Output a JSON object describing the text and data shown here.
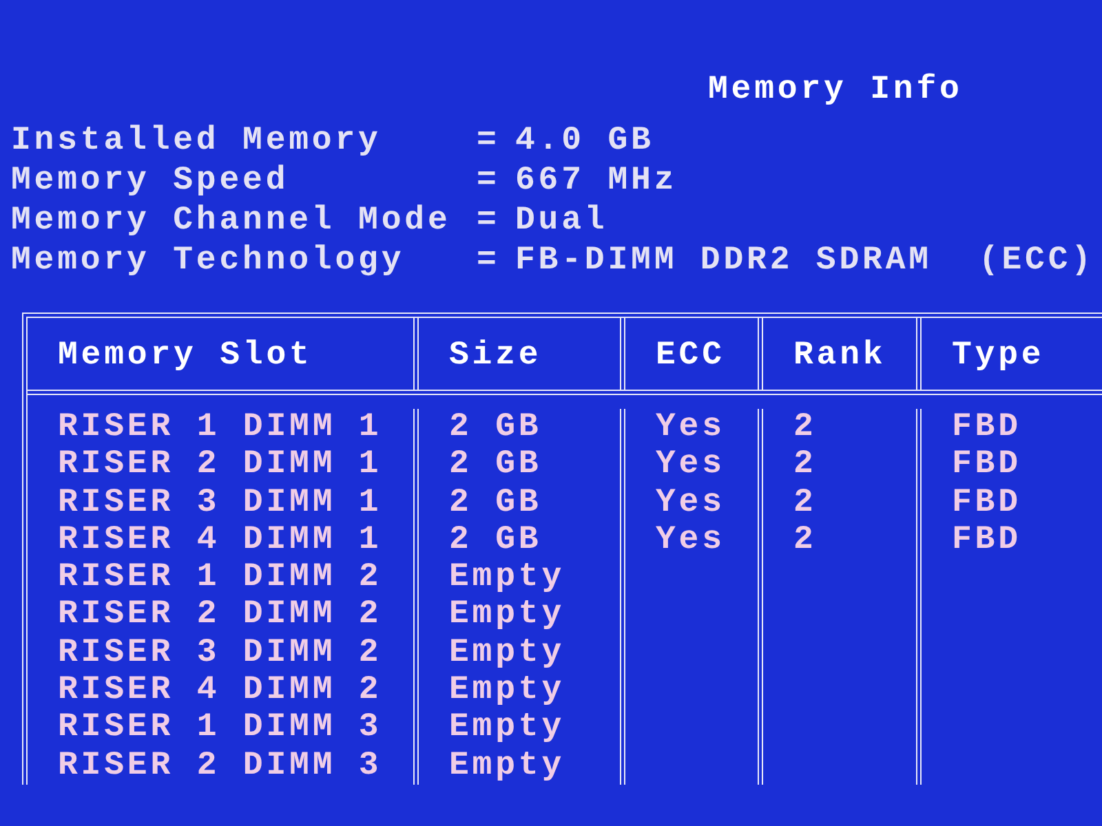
{
  "title": "Memory Info",
  "info": [
    {
      "label": "Installed Memory",
      "separator": "=",
      "value": "4.0 GB"
    },
    {
      "label": "Memory Speed",
      "separator": "=",
      "value": "667 MHz"
    },
    {
      "label": "Memory Channel Mode",
      "separator": "=",
      "value": "Dual"
    },
    {
      "label": "Memory Technology",
      "separator": "=",
      "value": "FB-DIMM DDR2 SDRAM",
      "note": "(ECC)"
    }
  ],
  "table": {
    "columns": [
      "Memory Slot",
      "Size",
      "ECC",
      "Rank",
      "Type"
    ],
    "rows": [
      [
        "RISER 1 DIMM 1",
        "2 GB",
        "Yes",
        "2",
        "FBD"
      ],
      [
        "RISER 2 DIMM 1",
        "2 GB",
        "Yes",
        "2",
        "FBD"
      ],
      [
        "RISER 3 DIMM 1",
        "2 GB",
        "Yes",
        "2",
        "FBD"
      ],
      [
        "RISER 4 DIMM 1",
        "2 GB",
        "Yes",
        "2",
        "FBD"
      ],
      [
        "RISER 1 DIMM 2",
        "Empty"
      ],
      [
        "RISER 2 DIMM 2",
        "Empty"
      ],
      [
        "RISER 3 DIMM 2",
        "Empty"
      ],
      [
        "RISER 4 DIMM 2",
        "Empty"
      ],
      [
        "RISER 1 DIMM 3",
        "Empty"
      ],
      [
        "RISER 2 DIMM 3",
        "Empty"
      ]
    ]
  }
}
